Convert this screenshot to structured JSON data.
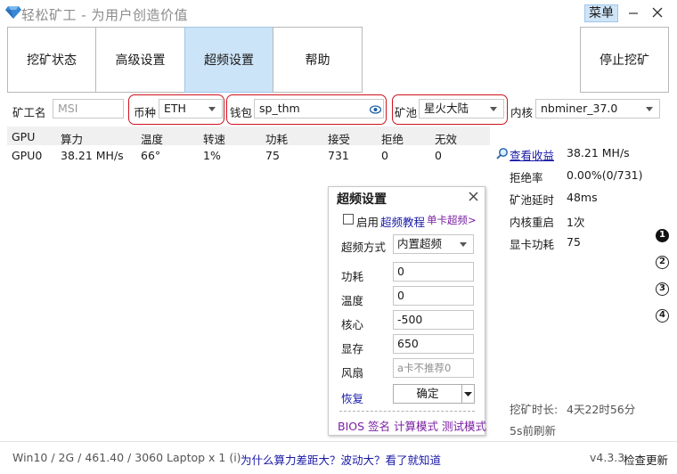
{
  "window": {
    "title": "轻松矿工 - 为用户创造价值",
    "menu_label": "菜单"
  },
  "tabs": [
    {
      "label": "挖矿状态"
    },
    {
      "label": "高级设置"
    },
    {
      "label": "超频设置"
    },
    {
      "label": "帮助"
    }
  ],
  "stop_button": "停止挖矿",
  "config": {
    "miner_name_label": "矿工名",
    "miner_name_placeholder": "MSI",
    "coin_label": "币种",
    "coin_value": "ETH",
    "wallet_label": "钱包",
    "wallet_value": "sp_thm",
    "pool_label": "矿池",
    "pool_value": "星火大陆",
    "kernel_label": "内核",
    "kernel_value": "nbminer_37.0"
  },
  "gpu_table": {
    "columns": [
      "GPU",
      "算力",
      "温度",
      "转速",
      "功耗",
      "接受",
      "拒绝",
      "无效"
    ],
    "rows": [
      [
        "GPU0",
        "38.21 MH/s",
        "66°",
        "1%",
        "75",
        "731",
        "0",
        "0"
      ]
    ]
  },
  "stats": {
    "earnings_link": "查看收益",
    "hashrate": "38.21 MH/s",
    "reject_rate_label": "拒绝率",
    "reject_rate_value": "0.00%(0/731)",
    "pool_latency_label": "矿池延时",
    "pool_latency_value": "48ms",
    "kernel_restart_label": "内核重启",
    "kernel_restart_value": "1次",
    "gpu_power_label": "显卡功耗",
    "gpu_power_value": "75",
    "mining_time_label": "挖矿时长:",
    "mining_time_value": "4天22时56分",
    "refresh_text": "5s前刷新",
    "page_numbers": [
      "1",
      "2",
      "3",
      "4"
    ]
  },
  "overclock_dialog": {
    "title": "超频设置",
    "enable_label": "启用",
    "tutorial_link": "超频教程",
    "single_card_link": "单卡超频>",
    "mode_label": "超频方式",
    "mode_value": "内置超频",
    "power_label": "功耗",
    "power_value": "0",
    "temp_label": "温度",
    "temp_value": "0",
    "core_label": "核心",
    "core_value": "-500",
    "memory_label": "显存",
    "memory_value": "650",
    "fan_label": "风扇",
    "fan_placeholder": "a卡不推荐0",
    "restore_link": "恢复",
    "confirm_button": "确定",
    "bottom_links": "BIOS 签名 计算模式 测试模式"
  },
  "footer": {
    "system_info": "Win10  / 2G / 461.40 / 3060 Laptop x 1 (i)",
    "help_link": "为什么算力差距大？波动大？看了就知道",
    "version": "v4.3.3",
    "update_link": "检查更新"
  },
  "colors": {
    "accent_tab": "#cce4f7",
    "link": "#1a1aa8",
    "purple_link": "#7a1fa2",
    "highlight_box": "#d0131e"
  }
}
